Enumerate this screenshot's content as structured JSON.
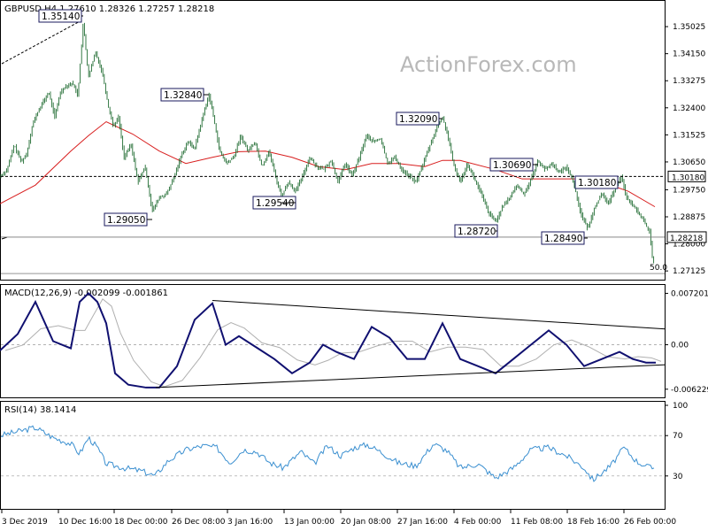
{
  "chart_data": [
    {
      "type": "candlestick",
      "symbol": "GBPUSD,H4",
      "title": "GBPUSD,H4 1.27610 1.28326 1.27257 1.28218",
      "ohlc": {
        "open": 1.2761,
        "high": 1.28326,
        "low": 1.27257,
        "close": 1.28218
      },
      "watermark": "ActionForex.com",
      "ylim": [
        1.269,
        1.358
      ],
      "yticks": [
        "1.35025",
        "1.34150",
        "1.33275",
        "1.32400",
        "1.31525",
        "1.30650",
        "1.29750",
        "1.28875",
        "1.28000",
        "1.27125"
      ],
      "x_ticks": [
        "3 Dec 2019",
        "10 Dec 16:00",
        "18 Dec 00:00",
        "26 Dec 08:00",
        "3 Jan 16:00",
        "13 Jan 00:00",
        "20 Jan 08:00",
        "27 Jan 16:00",
        "4 Feb 00:00",
        "11 Feb 08:00",
        "18 Feb 16:00",
        "26 Feb 00:00"
      ],
      "price_path": [
        [
          0,
          1.3018
        ],
        [
          8,
          1.304
        ],
        [
          16,
          1.312
        ],
        [
          24,
          1.3065
        ],
        [
          30,
          1.309
        ],
        [
          37,
          1.319
        ],
        [
          45,
          1.324
        ],
        [
          55,
          1.329
        ],
        [
          62,
          1.321
        ],
        [
          68,
          1.329
        ],
        [
          74,
          1.331
        ],
        [
          82,
          1.332
        ],
        [
          88,
          1.328
        ],
        [
          94,
          1.3514
        ],
        [
          100,
          1.334
        ],
        [
          108,
          1.342
        ],
        [
          116,
          1.335
        ],
        [
          122,
          1.325
        ],
        [
          128,
          1.318
        ],
        [
          134,
          1.321
        ],
        [
          140,
          1.308
        ],
        [
          148,
          1.312
        ],
        [
          156,
          1.3
        ],
        [
          164,
          1.305
        ],
        [
          172,
          1.2905
        ],
        [
          180,
          1.295
        ],
        [
          188,
          1.296
        ],
        [
          196,
          1.301
        ],
        [
          204,
          1.308
        ],
        [
          212,
          1.313
        ],
        [
          220,
          1.311
        ],
        [
          228,
          1.32
        ],
        [
          236,
          1.3284
        ],
        [
          242,
          1.32
        ],
        [
          248,
          1.31
        ],
        [
          256,
          1.306
        ],
        [
          264,
          1.308
        ],
        [
          272,
          1.315
        ],
        [
          280,
          1.31
        ],
        [
          288,
          1.313
        ],
        [
          296,
          1.305
        ],
        [
          304,
          1.31
        ],
        [
          312,
          1.301
        ],
        [
          318,
          1.2954
        ],
        [
          326,
          1.3
        ],
        [
          334,
          1.297
        ],
        [
          342,
          1.302
        ],
        [
          350,
          1.308
        ],
        [
          358,
          1.305
        ],
        [
          366,
          1.304
        ],
        [
          374,
          1.307
        ],
        [
          382,
          1.3
        ],
        [
          390,
          1.306
        ],
        [
          398,
          1.302
        ],
        [
          406,
          1.308
        ],
        [
          414,
          1.315
        ],
        [
          422,
          1.313
        ],
        [
          430,
          1.314
        ],
        [
          438,
          1.306
        ],
        [
          446,
          1.308
        ],
        [
          454,
          1.304
        ],
        [
          462,
          1.302
        ],
        [
          470,
          1.3
        ],
        [
          478,
          1.306
        ],
        [
          486,
          1.312
        ],
        [
          494,
          1.318
        ],
        [
          500,
          1.3209
        ],
        [
          506,
          1.315
        ],
        [
          512,
          1.306
        ],
        [
          520,
          1.3
        ],
        [
          528,
          1.306
        ],
        [
          536,
          1.301
        ],
        [
          544,
          1.296
        ],
        [
          552,
          1.29
        ],
        [
          560,
          1.2872
        ],
        [
          568,
          1.292
        ],
        [
          576,
          1.295
        ],
        [
          584,
          1.299
        ],
        [
          592,
          1.296
        ],
        [
          600,
          1.301
        ],
        [
          608,
          1.3069
        ],
        [
          616,
          1.304
        ],
        [
          624,
          1.306
        ],
        [
          632,
          1.303
        ],
        [
          640,
          1.305
        ],
        [
          648,
          1.3
        ],
        [
          656,
          1.29
        ],
        [
          664,
          1.2849
        ],
        [
          672,
          1.292
        ],
        [
          680,
          1.296
        ],
        [
          688,
          1.293
        ],
        [
          696,
          1.299
        ],
        [
          702,
          1.3018
        ],
        [
          708,
          1.295
        ],
        [
          716,
          1.292
        ],
        [
          722,
          1.29
        ],
        [
          728,
          1.287
        ],
        [
          734,
          1.284
        ],
        [
          738,
          1.2727
        ],
        [
          741,
          1.2822
        ]
      ],
      "ema_path": [
        [
          0,
          1.293
        ],
        [
          40,
          1.299
        ],
        [
          80,
          1.31
        ],
        [
          100,
          1.315
        ],
        [
          120,
          1.3195
        ],
        [
          150,
          1.3155
        ],
        [
          180,
          1.31
        ],
        [
          210,
          1.306
        ],
        [
          240,
          1.308
        ],
        [
          270,
          1.3098
        ],
        [
          300,
          1.31
        ],
        [
          330,
          1.308
        ],
        [
          360,
          1.305
        ],
        [
          390,
          1.304
        ],
        [
          420,
          1.306
        ],
        [
          450,
          1.306
        ],
        [
          480,
          1.305
        ],
        [
          500,
          1.307
        ],
        [
          520,
          1.307
        ],
        [
          560,
          1.304
        ],
        [
          590,
          1.301
        ],
        [
          620,
          1.301
        ],
        [
          650,
          1.301
        ],
        [
          680,
          1.3
        ],
        [
          710,
          1.297
        ],
        [
          740,
          1.292
        ]
      ],
      "levels": [
        {
          "label": "1.35140",
          "value": 1.3514
        },
        {
          "label": "1.32840",
          "value": 1.3284
        },
        {
          "label": "1.29050",
          "value": 1.2905
        },
        {
          "label": "1.29540",
          "value": 1.2954
        },
        {
          "label": "1.32090",
          "value": 1.3209
        },
        {
          "label": "1.28720",
          "value": 1.2872
        },
        {
          "label": "1.30690",
          "value": 1.3069
        },
        {
          "label": "1.30180",
          "value": 1.3018
        },
        {
          "label": "1.28490",
          "value": 1.2849
        }
      ],
      "current_price": "1.28218",
      "support_level": "1.30180",
      "fib_label": "50.0"
    },
    {
      "type": "line",
      "title": "MACD(12,26,9) -0.002099 -0.001861",
      "yticks": [
        "0.007201",
        "0.00",
        "-0.006229"
      ],
      "macd_points": [
        [
          0,
          -0.0008
        ],
        [
          20,
          0.0015
        ],
        [
          40,
          0.006
        ],
        [
          60,
          0.0005
        ],
        [
          80,
          -0.0005
        ],
        [
          90,
          0.006
        ],
        [
          100,
          0.0072
        ],
        [
          110,
          0.006
        ],
        [
          120,
          0.003
        ],
        [
          130,
          -0.004
        ],
        [
          145,
          -0.0056
        ],
        [
          165,
          -0.006
        ],
        [
          180,
          -0.006
        ],
        [
          200,
          -0.003
        ],
        [
          220,
          0.0035
        ],
        [
          240,
          0.0058
        ],
        [
          255,
          0.0
        ],
        [
          270,
          0.0012
        ],
        [
          290,
          -0.0004
        ],
        [
          310,
          -0.002
        ],
        [
          330,
          -0.004
        ],
        [
          350,
          -0.0025
        ],
        [
          365,
          0.0
        ],
        [
          380,
          -0.001
        ],
        [
          400,
          -0.002
        ],
        [
          420,
          0.0025
        ],
        [
          440,
          0.001
        ],
        [
          460,
          -0.002
        ],
        [
          480,
          -0.002
        ],
        [
          500,
          0.003
        ],
        [
          520,
          -0.002
        ],
        [
          540,
          -0.003
        ],
        [
          560,
          -0.004
        ],
        [
          580,
          -0.002
        ],
        [
          600,
          0.0
        ],
        [
          620,
          0.002
        ],
        [
          640,
          0.0
        ],
        [
          660,
          -0.003
        ],
        [
          680,
          -0.002
        ],
        [
          700,
          -0.001
        ],
        [
          715,
          -0.002
        ],
        [
          730,
          -0.0025
        ],
        [
          741,
          -0.0025
        ]
      ],
      "trendlines": [
        {
          "from": [
            240,
            0.0062
          ],
          "to": [
            752,
            0.0022
          ]
        },
        {
          "from": [
            176,
            -0.006
          ],
          "to": [
            752,
            -0.0028
          ]
        }
      ]
    },
    {
      "type": "line",
      "title": "RSI(14) 38.1414",
      "yticks": [
        "100",
        "70",
        "30"
      ],
      "ylim": [
        0,
        100
      ],
      "rsi_points": [
        [
          0,
          70
        ],
        [
          20,
          74
        ],
        [
          40,
          78
        ],
        [
          60,
          68
        ],
        [
          80,
          62
        ],
        [
          90,
          52
        ],
        [
          100,
          68
        ],
        [
          110,
          58
        ],
        [
          120,
          42
        ],
        [
          140,
          38
        ],
        [
          160,
          35
        ],
        [
          175,
          30
        ],
        [
          190,
          45
        ],
        [
          210,
          56
        ],
        [
          230,
          60
        ],
        [
          245,
          58
        ],
        [
          260,
          43
        ],
        [
          275,
          56
        ],
        [
          290,
          54
        ],
        [
          305,
          43
        ],
        [
          320,
          38
        ],
        [
          340,
          54
        ],
        [
          355,
          42
        ],
        [
          370,
          60
        ],
        [
          385,
          50
        ],
        [
          400,
          58
        ],
        [
          415,
          61
        ],
        [
          430,
          54
        ],
        [
          450,
          43
        ],
        [
          470,
          40
        ],
        [
          490,
          62
        ],
        [
          505,
          55
        ],
        [
          520,
          38
        ],
        [
          540,
          42
        ],
        [
          560,
          28
        ],
        [
          580,
          38
        ],
        [
          600,
          56
        ],
        [
          620,
          58
        ],
        [
          640,
          50
        ],
        [
          660,
          38
        ],
        [
          670,
          26
        ],
        [
          690,
          40
        ],
        [
          705,
          58
        ],
        [
          720,
          44
        ],
        [
          735,
          38
        ],
        [
          741,
          38
        ]
      ]
    }
  ]
}
